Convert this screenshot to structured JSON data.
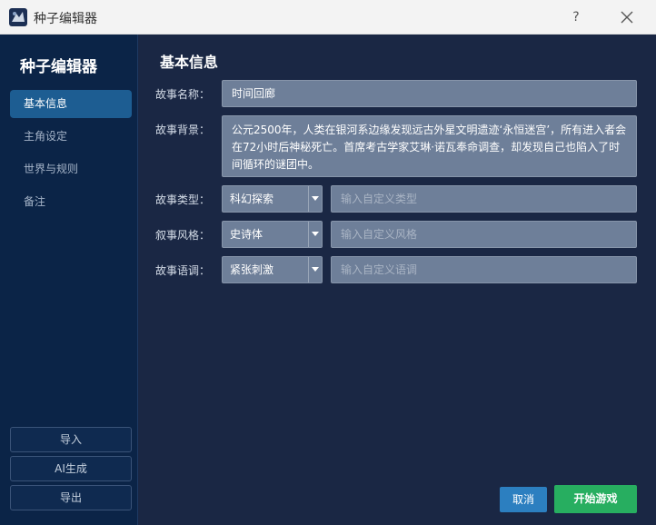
{
  "window": {
    "title": "种子编辑器",
    "help_label": "?"
  },
  "sidebar": {
    "title": "种子编辑器",
    "nav": [
      {
        "label": "基本信息",
        "active": true
      },
      {
        "label": "主角设定",
        "active": false
      },
      {
        "label": "世界与规则",
        "active": false
      },
      {
        "label": "备注",
        "active": false
      }
    ],
    "actions": {
      "import_label": "导入",
      "ai_generate_label": "AI生成",
      "export_label": "导出"
    }
  },
  "main": {
    "section_title": "基本信息",
    "story_name": {
      "label": "故事名称：",
      "value": "时间回廊"
    },
    "story_background": {
      "label": "故事背景：",
      "value": "公元2500年，人类在银河系边缘发现远古外星文明遗迹‘永恒迷宫’，所有进入者会在72小时后神秘死亡。首席考古学家艾琳·诺瓦奉命调查，却发现自己也陷入了时间循环的谜团中。"
    },
    "story_type": {
      "label": "故事类型：",
      "selected": "科幻探索",
      "custom_placeholder": "输入自定义类型"
    },
    "narrative_style": {
      "label": "叙事风格：",
      "selected": "史诗体",
      "custom_placeholder": "输入自定义风格"
    },
    "story_tone": {
      "label": "故事语调：",
      "selected": "紧张刺激",
      "custom_placeholder": "输入自定义语调"
    }
  },
  "footer": {
    "cancel_label": "取消",
    "start_label": "开始游戏"
  },
  "colors": {
    "sidebar_bg": "#0b2447",
    "main_bg": "#1a2744",
    "active_nav": "#1d5d92",
    "input_bg": "#6e7f99",
    "cancel": "#2c7fc0",
    "start": "#27ae60"
  }
}
